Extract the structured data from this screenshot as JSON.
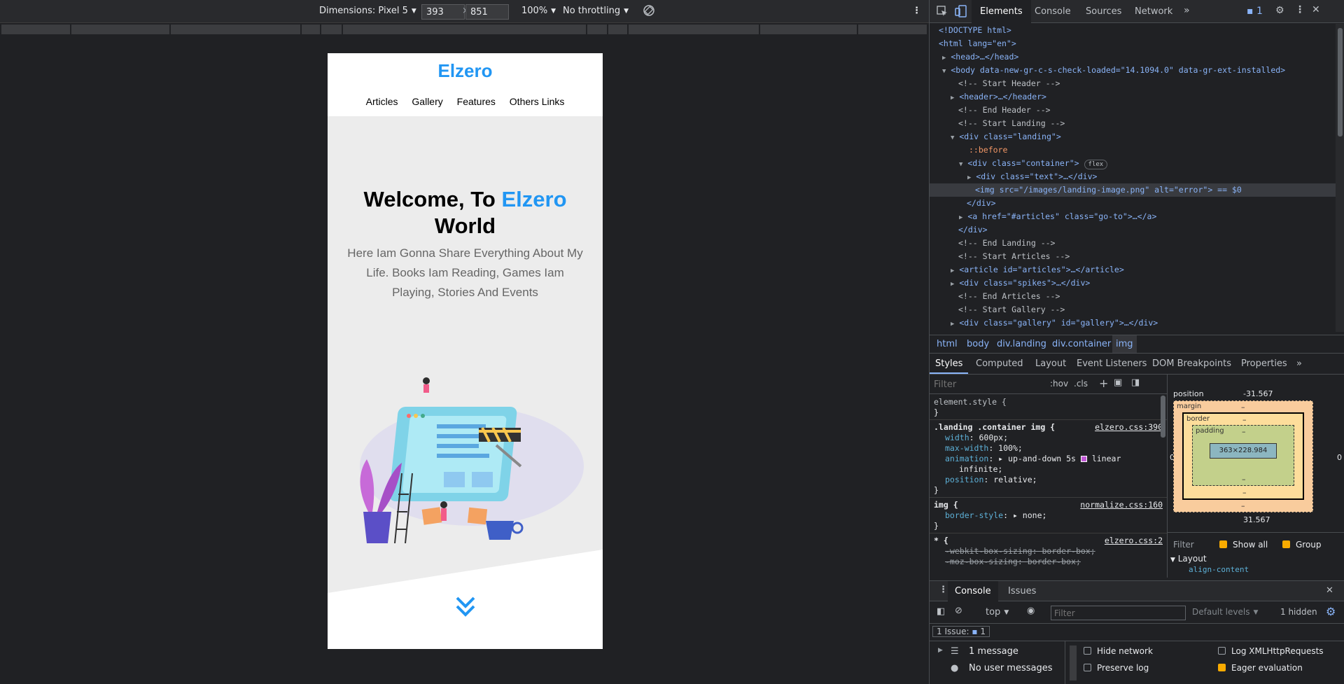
{
  "device_toolbar": {
    "dimensions_label": "Dimensions: Pixel 5",
    "width_value": "393",
    "times": "×",
    "height_value": "851",
    "zoom": "100%",
    "throttling": "No throttling"
  },
  "site": {
    "logo": "Elzero",
    "nav": [
      "Articles",
      "Gallery",
      "Features",
      "Others Links"
    ],
    "hero_title_part1": "Welcome, To",
    "hero_title_accent": "Elzero",
    "hero_title_part2": "World",
    "hero_subtitle": "Here Iam Gonna Share Everything About My Life. Books Iam Reading, Games Iam Playing, Stories And Events",
    "accent_color": "#2196f3"
  },
  "devtools": {
    "tabs": [
      "Elements",
      "Console",
      "Sources",
      "Network"
    ],
    "issues_count": "1",
    "dom": [
      {
        "pre": "<!DOCTYPE html>"
      },
      {
        "pre": "<html lang=\"en\">"
      },
      {
        "pre": "<head>…</head>"
      },
      {
        "pre": "<body data-new-gr-c-s-check-loaded=\"14.1094.0\" data-gr-ext-installed>"
      },
      {
        "pre": "<!-- Start Header -->"
      },
      {
        "pre": "<header>…</header>"
      },
      {
        "pre": "<!-- End Header -->"
      },
      {
        "pre": "<!-- Start Landing -->"
      },
      {
        "pre": "<div class=\"landing\">"
      },
      {
        "pre": "::before"
      },
      {
        "pre": "<div class=\"container\">"
      },
      {
        "pre": "<div class=\"text\">…</div>"
      },
      {
        "pre": "<img src=\"/images/landing-image.png\" alt=\"error\"> == $0"
      },
      {
        "pre": "</div>"
      },
      {
        "pre": "<a href=\"#articles\" class=\"go-to\">…</a>"
      },
      {
        "pre": "</div>"
      },
      {
        "pre": "<!-- End Landing -->"
      },
      {
        "pre": "<!-- Start Articles -->"
      },
      {
        "pre": "<article id=\"articles\">…</article>"
      },
      {
        "pre": "<div class=\"spikes\">…</div>"
      },
      {
        "pre": "<!-- End Articles -->"
      },
      {
        "pre": "<!-- Start Gallery -->"
      },
      {
        "pre": "<div class=\"gallery\" id=\"gallery\">…</div>"
      }
    ],
    "flex_badge": "flex",
    "breadcrumbs": [
      "html",
      "body",
      "div.landing",
      "div.container",
      "img"
    ],
    "sub_tabs": [
      "Styles",
      "Computed",
      "Layout",
      "Event Listeners",
      "DOM Breakpoints",
      "Properties"
    ],
    "styles_filter_placeholder": "Filter",
    "hov": ":hov",
    "cls": ".cls",
    "rules": {
      "element_style": "element.style {",
      "close": "}",
      "rule1_selector": ".landing .container img {",
      "rule1_source": "elzero.css:390",
      "rule1_props": [
        {
          "p": "width",
          "v": "600px;"
        },
        {
          "p": "max-width",
          "v": "100%;"
        },
        {
          "p": "animation",
          "v": "▸ up-and-down 5s"
        },
        {
          "p": "",
          "v": "linear"
        },
        {
          "p": "",
          "v": "infinite;"
        },
        {
          "p": "position",
          "v": "relative;"
        }
      ],
      "rule2_selector": "img {",
      "rule2_source": "normalize.css:160",
      "rule2_prop": "border-style",
      "rule2_value": "▸ none;",
      "rule3_selector": "* {",
      "rule3_source": "elzero.css:2",
      "rule3_prop1": "-webkit-box-sizing",
      "rule3_value1": "border-box;",
      "rule3_prop2": "-moz-box-sizing",
      "rule3_value2": "border-box;"
    },
    "box_model": {
      "position_label": "position",
      "position_top": "-31.567",
      "position_bottom": "31.567",
      "position_side": "0",
      "margin": "margin",
      "border": "border",
      "padding": "padding",
      "content": "363×228.984",
      "dash": "–"
    },
    "computed_filter": "Filter",
    "show_all": "Show all",
    "group": "Group",
    "layout_section": "Layout",
    "layout_prop": "align-content",
    "drawer_tabs": [
      "Console",
      "Issues"
    ],
    "console_context": "top",
    "console_filter_placeholder": "Filter",
    "default_levels": "Default levels",
    "hidden_count": "1 hidden",
    "issues_label": "1 Issue:",
    "issues_badge": "1",
    "messages": [
      "1 message",
      "No user messages"
    ],
    "options": [
      {
        "label": "Hide network",
        "checked": false
      },
      {
        "label": "Log XMLHttpRequests",
        "checked": false
      },
      {
        "label": "Preserve log",
        "checked": false
      },
      {
        "label": "Eager evaluation",
        "checked": true
      }
    ]
  }
}
